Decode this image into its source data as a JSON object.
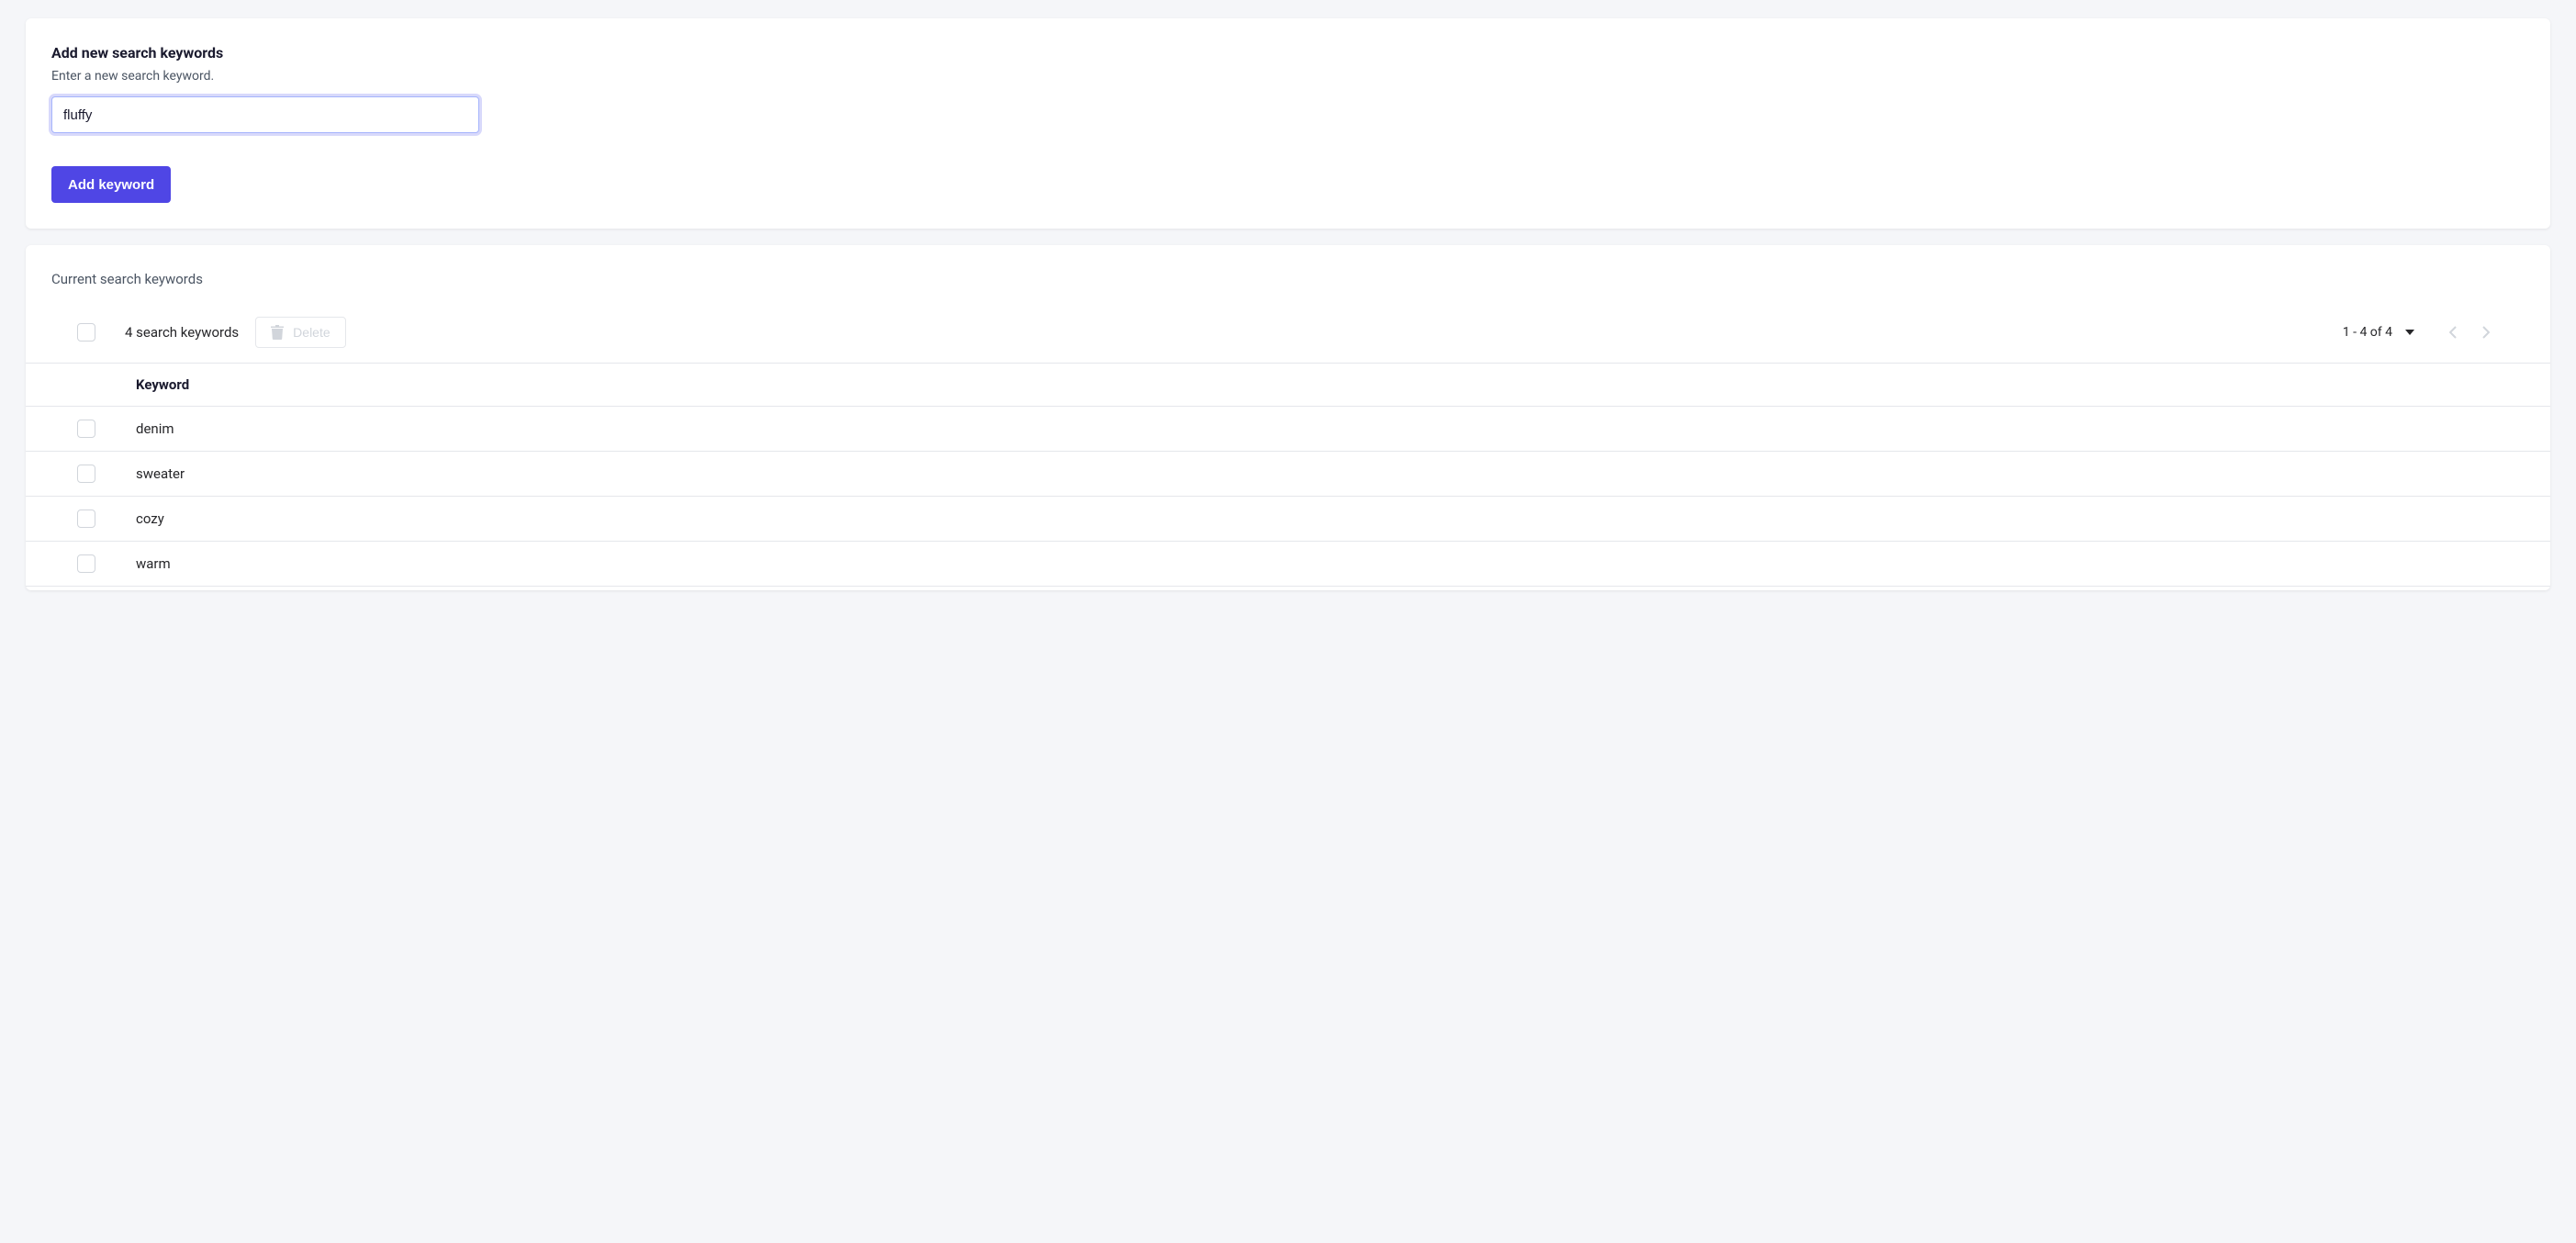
{
  "form": {
    "title": "Add new search keywords",
    "subtitle": "Enter a new search keyword.",
    "input_value": "fluffy",
    "add_button_label": "Add keyword"
  },
  "list": {
    "title": "Current search keywords",
    "count_label": "4 search keywords",
    "delete_label": "Delete",
    "pagination_label": "1 - 4 of 4",
    "column_header": "Keyword",
    "rows": [
      {
        "keyword": "denim"
      },
      {
        "keyword": "sweater"
      },
      {
        "keyword": "cozy"
      },
      {
        "keyword": "warm"
      }
    ]
  }
}
